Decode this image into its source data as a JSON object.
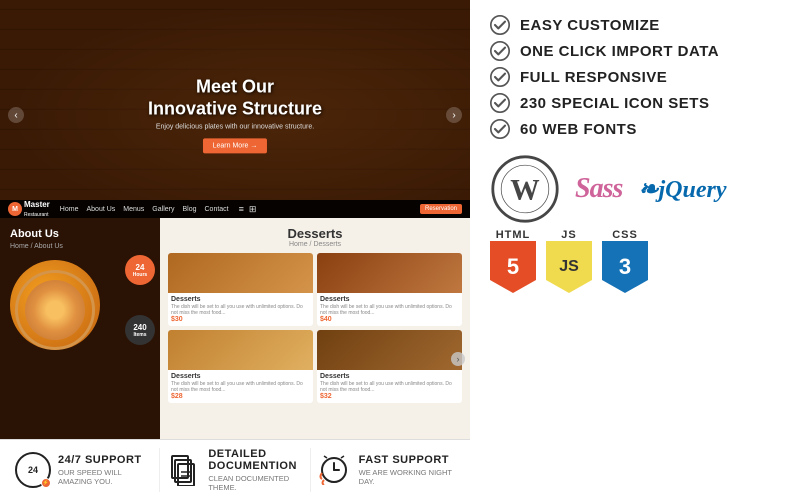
{
  "features": [
    {
      "label": "EASY CUSTOMIZE",
      "id": "easy-customize"
    },
    {
      "label": "ONE CLICK IMPORT DATA",
      "id": "one-click-import"
    },
    {
      "label": "FULL RESPONSIVE",
      "id": "full-responsive"
    },
    {
      "label": "230 SPECIAL ICON SETS",
      "id": "icon-sets"
    },
    {
      "label": "60 WEB FONTS",
      "id": "web-fonts"
    }
  ],
  "hero": {
    "title": "Meet Our",
    "title2": "Innovative Structure",
    "subtitle": "Enjoy delicious plates with our innovative structure.",
    "btn": "Learn More →"
  },
  "nav": {
    "brand": "Master",
    "sub": "Restaurant",
    "links": [
      "Home",
      "About Us",
      "Menus",
      "Gallery",
      "Blog",
      "Contact"
    ],
    "reservation": "Reservation"
  },
  "about": {
    "title": "About Us",
    "breadcrumb": "Home / About Us",
    "badge1": "24",
    "badge1_sub": "Hours",
    "badge2": "240",
    "badge2_sub": "Items"
  },
  "desserts": {
    "title": "Desserts",
    "breadcrumb": "Home / Desserts",
    "items": [
      {
        "name": "Desserts",
        "price": "$30"
      },
      {
        "name": "Desserts",
        "price": "$40"
      },
      {
        "name": "Desserts",
        "price": "$28"
      },
      {
        "name": "Desserts",
        "price": "$32"
      }
    ]
  },
  "tech": {
    "sass": "Sass",
    "jquery": "jQuery",
    "html_label": "HTML",
    "html_num": "5",
    "js_label": "JS",
    "js_num": "JS",
    "css_label": "CSS",
    "css_num": "3"
  },
  "stats": [
    {
      "icon": "clock-24",
      "title": "24/7 SUPPORT",
      "sub": "OUR SPEED WILL AMAZING YOU."
    },
    {
      "icon": "docs",
      "title": "DETAILED DOCUMENTION",
      "sub": "CLEAN DOCUMENTED THEME."
    },
    {
      "icon": "fast-support",
      "title": "FAST SUPPORT",
      "sub": "WE ARE WORKING NIGHT DAY."
    }
  ]
}
